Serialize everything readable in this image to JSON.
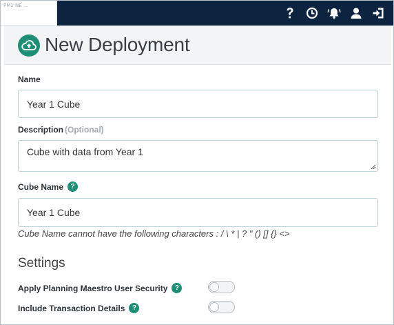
{
  "topbar": {
    "logo_text": "PM1 NE ...",
    "icons": [
      "help-icon",
      "history-icon",
      "notifications-icon",
      "user-icon",
      "logout-icon"
    ]
  },
  "header": {
    "icon": "cloud-upload-icon",
    "title": "New Deployment"
  },
  "form": {
    "name_label": "Name",
    "name_value": "Year 1 Cube",
    "description_label": "Description",
    "description_optional": "(Optional)",
    "description_value": "Cube with data from Year 1",
    "cube_name_label": "Cube Name",
    "cube_name_value": "Year 1 Cube",
    "cube_name_hint": "Cube Name cannot have the following characters : / \\ * | ? \" () [] {} <>"
  },
  "settings": {
    "title": "Settings",
    "apply_security_label": "Apply Planning Maestro User Security",
    "apply_security_on": false,
    "include_transactions_label": "Include Transaction Details",
    "include_transactions_on": false
  },
  "help_glyph": "?",
  "colors": {
    "topbar": "#0d2440",
    "accent": "#1e8f76"
  }
}
